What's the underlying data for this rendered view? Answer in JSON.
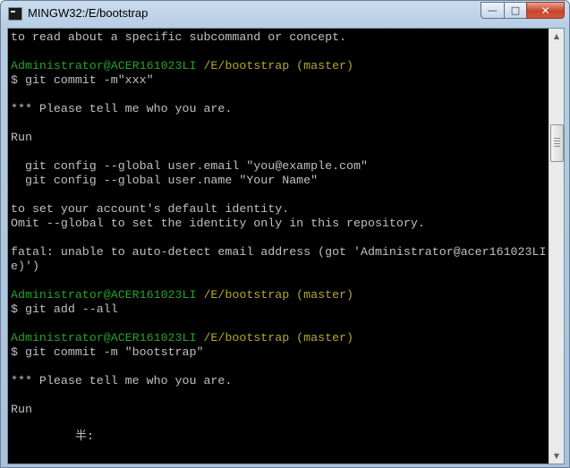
{
  "window": {
    "title": "MINGW32:/E/bootstrap",
    "icons": {
      "app": "terminal-icon",
      "minimize": "minimize-icon",
      "maximize": "maximize-icon",
      "close": "close-icon"
    },
    "buttons": {
      "minimize": "—",
      "maximize": "□",
      "close": "✕"
    }
  },
  "terminal": {
    "colors": {
      "background": "#000000",
      "text": "#c0c0c0",
      "user": "#27a12a",
      "path": "#b5a82b"
    },
    "lines": [
      "to read about a specific subcommand or concept.",
      "",
      "",
      "$ git commit -m\"xxx\"",
      "",
      "*** Please tell me who you are.",
      "",
      "Run",
      "",
      "  git config --global user.email \"you@example.com\"",
      "  git config --global user.name \"Your Name\"",
      "",
      "to set your account's default identity.",
      "Omit --global to set the identity only in this repository.",
      "",
      "fatal: unable to auto-detect email address (got 'Administrator@acer161023LI",
      "e)')",
      "",
      "",
      "$ git add --all",
      "",
      "",
      "$ git commit -m \"bootstrap\"",
      "",
      "*** Please tell me who you are.",
      "",
      "Run"
    ],
    "prompts": [
      {
        "user": "Administrator@ACER161023LI",
        "path": "/E/bootstrap (master)"
      },
      {
        "user": "Administrator@ACER161023LI",
        "path": "/E/bootstrap (master)"
      },
      {
        "user": "Administrator@ACER161023LI",
        "path": "/E/bootstrap (master)"
      }
    ],
    "ime_composition": "半:"
  },
  "scrollbar": {
    "up_arrow": "▲",
    "down_arrow": "▼",
    "icons": {
      "up": "arrow-up-icon",
      "down": "arrow-down-icon"
    }
  }
}
